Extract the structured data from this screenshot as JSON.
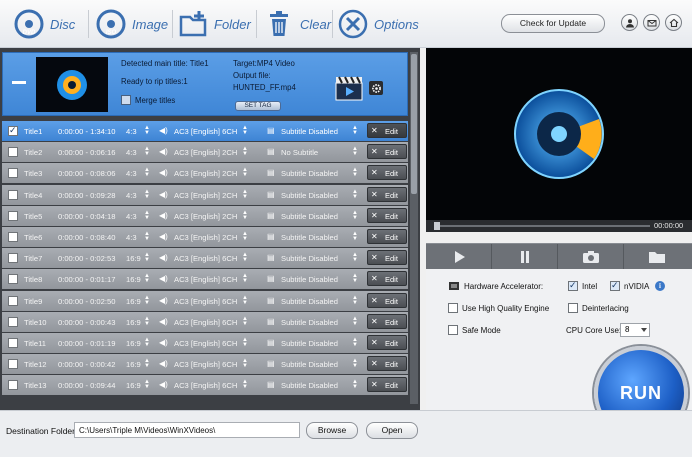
{
  "toolbar": {
    "disc": "Disc",
    "image": "Image",
    "folder": "Folder",
    "clear": "Clear",
    "options": "Options",
    "check_update": "Check for Update"
  },
  "header": {
    "detected": "Detected main title: Title1",
    "ready": "Ready to rip titles:1",
    "merge": "Merge titles",
    "target": "Target:MP4 Video",
    "output_label": "Output file:",
    "output_file": "HUNTED_FF.mp4",
    "settag": "SET TAG"
  },
  "rows": [
    {
      "name": "Title1",
      "time": "0:00:00 - 1:34:10",
      "ratio": "4:3",
      "audio": "AC3  [English]  6CH",
      "subtitle": "Subtitle Disabled",
      "edit": "Edit",
      "checked": true
    },
    {
      "name": "Title2",
      "time": "0:00:00 - 0:06:16",
      "ratio": "4:3",
      "audio": "AC3  [English]  2CH",
      "subtitle": "No Subtitle",
      "edit": "Edit",
      "checked": false
    },
    {
      "name": "Title3",
      "time": "0:00:00 - 0:08:06",
      "ratio": "4:3",
      "audio": "AC3  [English]  2CH",
      "subtitle": "Subtitle Disabled",
      "edit": "Edit",
      "checked": false
    },
    {
      "name": "Title4",
      "time": "0:00:00 - 0:09:28",
      "ratio": "4:3",
      "audio": "AC3  [English]  2CH",
      "subtitle": "Subtitle Disabled",
      "edit": "Edit",
      "checked": false
    },
    {
      "name": "Title5",
      "time": "0:00:00 - 0:04:18",
      "ratio": "4:3",
      "audio": "AC3  [English]  2CH",
      "subtitle": "Subtitle Disabled",
      "edit": "Edit",
      "checked": false
    },
    {
      "name": "Title6",
      "time": "0:00:00 - 0:08:40",
      "ratio": "4:3",
      "audio": "AC3  [English]  2CH",
      "subtitle": "Subtitle Disabled",
      "edit": "Edit",
      "checked": false
    },
    {
      "name": "Title7",
      "time": "0:00:00 - 0:02:53",
      "ratio": "16:9",
      "audio": "AC3  [English]  6CH",
      "subtitle": "Subtitle Disabled",
      "edit": "Edit",
      "checked": false
    },
    {
      "name": "Title8",
      "time": "0:00:00 - 0:01:17",
      "ratio": "16:9",
      "audio": "AC3  [English]  6CH",
      "subtitle": "Subtitle Disabled",
      "edit": "Edit",
      "checked": false
    },
    {
      "name": "Title9",
      "time": "0:00:00 - 0:02:50",
      "ratio": "16:9",
      "audio": "AC3  [English]  6CH",
      "subtitle": "Subtitle Disabled",
      "edit": "Edit",
      "checked": false
    },
    {
      "name": "Title10",
      "time": "0:00:00 - 0:00:43",
      "ratio": "16:9",
      "audio": "AC3  [English]  6CH",
      "subtitle": "Subtitle Disabled",
      "edit": "Edit",
      "checked": false
    },
    {
      "name": "Title11",
      "time": "0:00:00 - 0:01:19",
      "ratio": "16:9",
      "audio": "AC3  [English]  6CH",
      "subtitle": "Subtitle Disabled",
      "edit": "Edit",
      "checked": false
    },
    {
      "name": "Title12",
      "time": "0:00:00 - 0:00:42",
      "ratio": "16:9",
      "audio": "AC3  [English]  6CH",
      "subtitle": "Subtitle Disabled",
      "edit": "Edit",
      "checked": false
    },
    {
      "name": "Title13",
      "time": "0:00:00 - 0:09:44",
      "ratio": "16:9",
      "audio": "AC3  [English]  6CH",
      "subtitle": "Subtitle Disabled",
      "edit": "Edit",
      "checked": false
    }
  ],
  "bottom": {
    "dest_label": "Destination Folder:",
    "dest_path": "C:\\Users\\Triple M\\Videos\\WinXVideos\\",
    "browse": "Browse",
    "open": "Open"
  },
  "player": {
    "time": "00:00:00"
  },
  "options": {
    "hw_accel": "Hardware Accelerator:",
    "intel": "Intel",
    "nvidia": "nVIDIA",
    "hq_engine": "Use High Quality Engine",
    "deinterlacing": "Deinterlacing",
    "safe_mode": "Safe Mode",
    "cpu_core": "CPU Core Use:",
    "cpu_value": "8"
  },
  "run": "RUN",
  "colors": {
    "accent_blue": "#3f86d6",
    "row_gray": "#9da1a7",
    "run_blue": "#1d5fc6"
  }
}
